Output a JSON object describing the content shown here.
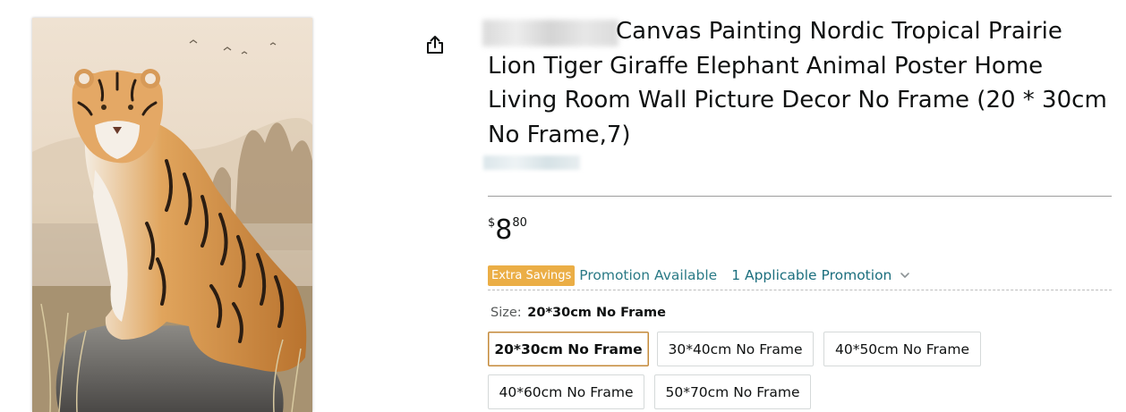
{
  "product": {
    "title": "Canvas Painting Nordic Tropical Prairie Lion Tiger Giraffe Elephant Animal Poster Home Living Room Wall Picture Decor No Frame (20 * 30cm No Frame,7)",
    "image_icon": "tiger-painting"
  },
  "actions": {
    "share_icon": "share-icon"
  },
  "price": {
    "symbol": "$",
    "whole": "8",
    "fraction": "80"
  },
  "promotion": {
    "badge": "Extra Savings",
    "text": "Promotion Available",
    "link": "1 Applicable Promotion",
    "badge_color": "#ebae46",
    "link_color": "#1c6f7e"
  },
  "size": {
    "label": "Size:",
    "selected": "20*30cm No Frame",
    "options": [
      {
        "label": "20*30cm No Frame",
        "selected": true
      },
      {
        "label": "30*40cm No Frame",
        "selected": false
      },
      {
        "label": "40*50cm No Frame",
        "selected": false
      },
      {
        "label": "40*60cm No Frame",
        "selected": false
      },
      {
        "label": "50*70cm No Frame",
        "selected": false
      }
    ],
    "selected_border_color": "#c48a3a"
  }
}
